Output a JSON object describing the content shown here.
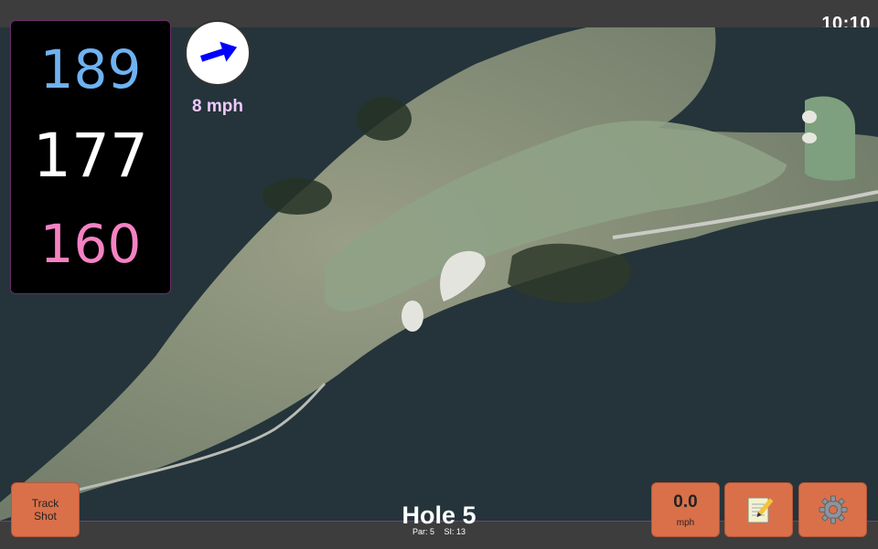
{
  "status": {
    "time": "10:10"
  },
  "distances": {
    "back": "189",
    "middle": "177",
    "front": "160"
  },
  "wind": {
    "speed": "8 mph",
    "icon": "arrow-right-icon",
    "color": "#0000ff"
  },
  "buttons": {
    "track_shot_line1": "Track",
    "track_shot_line2": "Shot",
    "speed_value": "0.0",
    "speed_unit": "mph",
    "notes_icon": "notepad-icon",
    "settings_icon": "gear-icon"
  },
  "hole": {
    "title": "Hole 5",
    "par": "Par: 5",
    "si": "SI: 13"
  },
  "colors": {
    "accent_orange": "#d9704a",
    "back_blue": "#6fb2f2",
    "front_pink": "#f582c3",
    "bar_border": "#7a3c7a"
  }
}
